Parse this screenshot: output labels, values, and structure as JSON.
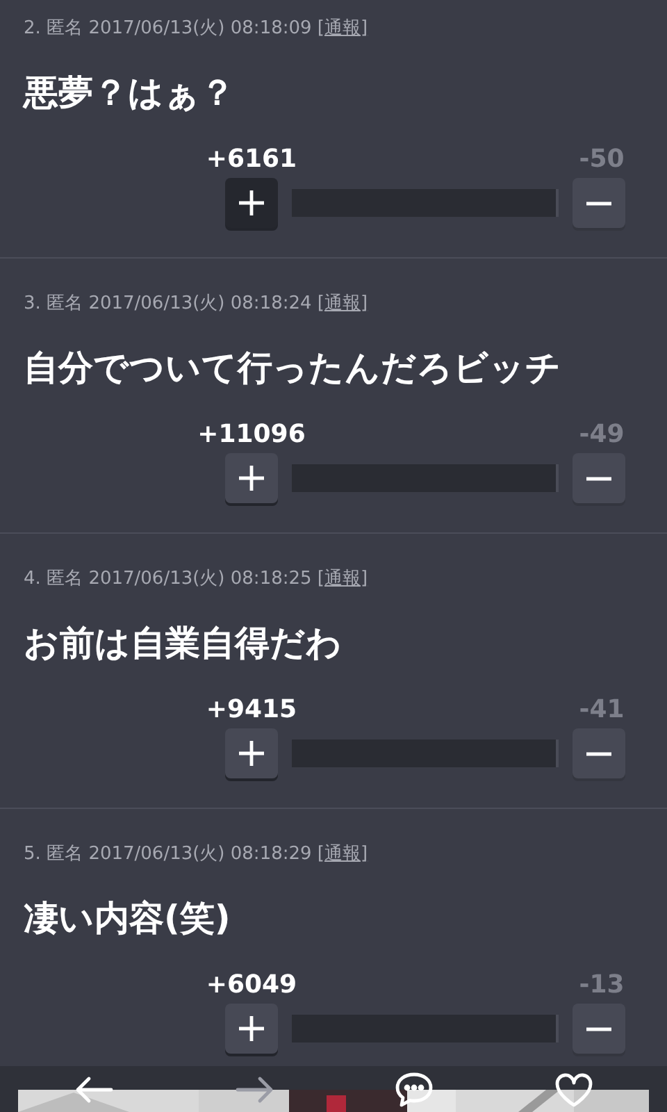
{
  "posts": [
    {
      "number": "2.",
      "author": "匿名",
      "date": "2017/06/13(火) 08:18:09",
      "report": "[通報]",
      "text": "悪夢？はぁ？",
      "plus": "+6161",
      "minus": "-50",
      "level": 0.99,
      "plus_selected": true
    },
    {
      "number": "3.",
      "author": "匿名",
      "date": "2017/06/13(火) 08:18:24",
      "report": "[通報]",
      "text": "自分でついて行ったんだろビッチ",
      "plus": "+11096",
      "minus": "-49",
      "level": 0.99,
      "plus_selected": false
    },
    {
      "number": "4.",
      "author": "匿名",
      "date": "2017/06/13(火) 08:18:25",
      "report": "[通報]",
      "text": "お前は自業自得だわ",
      "plus": "+9415",
      "minus": "-41",
      "level": 0.99,
      "plus_selected": false
    },
    {
      "number": "5.",
      "author": "匿名",
      "date": "2017/06/13(火) 08:18:29",
      "report": "[通報]",
      "text": "凄い内容(笑)",
      "plus": "+6049",
      "minus": "-13",
      "level": 0.99,
      "plus_selected": false
    }
  ],
  "nav": [
    {
      "kind": "back",
      "disabled": false
    },
    {
      "kind": "forward",
      "disabled": true
    },
    {
      "kind": "comment",
      "disabled": false
    },
    {
      "kind": "favorite",
      "disabled": false
    }
  ]
}
